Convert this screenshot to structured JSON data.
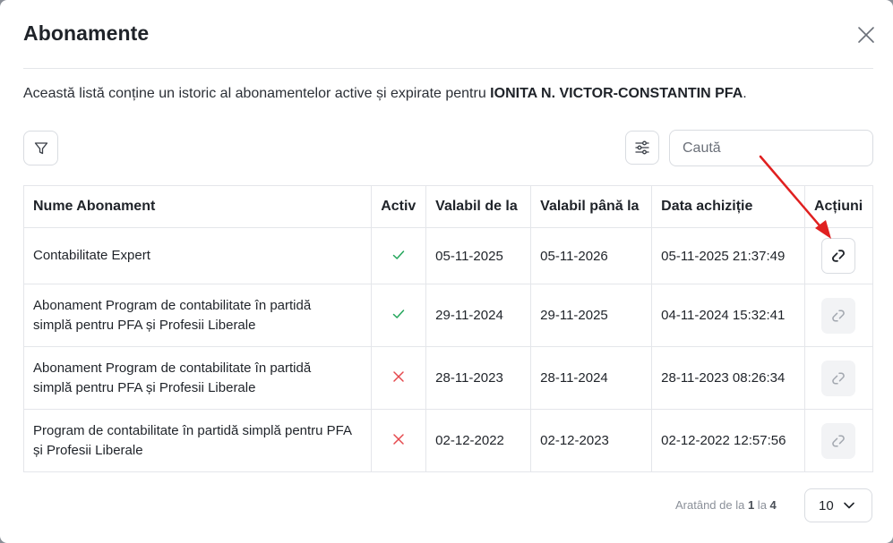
{
  "modal": {
    "title": "Abonamente",
    "description_prefix": "Această listă conține un istoric al abonamentelor active și expirate pentru ",
    "entity_name": "IONITA N. VICTOR-CONSTANTIN PFA",
    "description_suffix": "."
  },
  "toolbar": {
    "search_placeholder": "Caută"
  },
  "table": {
    "columns": [
      "Nume Abonament",
      "Activ",
      "Valabil de la",
      "Valabil până la",
      "Data achiziție",
      "Acțiuni"
    ],
    "rows": [
      {
        "name": "Contabilitate Expert",
        "active": true,
        "valid_from": "05-11-2025",
        "valid_to": "05-11-2026",
        "purchase_date": "05-11-2025 21:37:49",
        "action_enabled": true
      },
      {
        "name": "Abonament Program de contabilitate în partidă simplă pentru PFA și Profesii Liberale",
        "active": true,
        "valid_from": "29-11-2024",
        "valid_to": "29-11-2025",
        "purchase_date": "04-11-2024 15:32:41",
        "action_enabled": false
      },
      {
        "name": "Abonament Program de contabilitate în partidă simplă pentru PFA și Profesii Liberale",
        "active": false,
        "valid_from": "28-11-2023",
        "valid_to": "28-11-2024",
        "purchase_date": "28-11-2023 08:26:34",
        "action_enabled": false
      },
      {
        "name": "Program de contabilitate în partidă simplă pentru PFA și Profesii Liberale",
        "active": false,
        "valid_from": "02-12-2022",
        "valid_to": "02-12-2023",
        "purchase_date": "02-12-2022 12:57:56",
        "action_enabled": false
      }
    ]
  },
  "pagination": {
    "text_prefix": "Aratând de la ",
    "from": "1",
    "text_middle": " la ",
    "to": "4",
    "page_size": "10"
  },
  "icons": {
    "close": "close-icon",
    "filter": "filter-icon",
    "settings": "sliders-icon",
    "active": "check-icon",
    "inactive": "x-icon",
    "action": "link-icon",
    "page_size": "chevron-down-icon"
  },
  "colors": {
    "active_check": "#22a55a",
    "inactive_x": "#e5484d",
    "annotation_arrow": "#e02020"
  }
}
